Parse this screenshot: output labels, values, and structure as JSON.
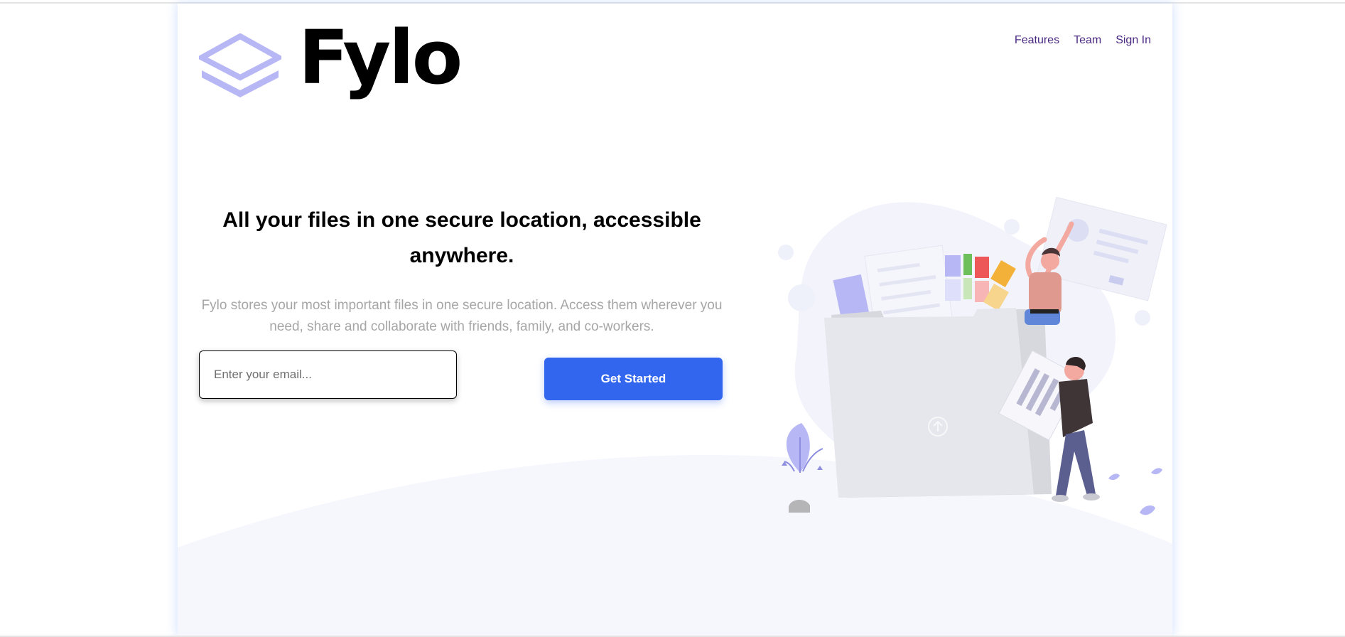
{
  "brand": {
    "name": "Fylo",
    "logo_color": "#b7b7f5"
  },
  "nav": {
    "features": "Features",
    "team": "Team",
    "sign_in": "Sign In"
  },
  "hero": {
    "headline": "All your files in one secure location, accessible anywhere.",
    "subtext": "Fylo stores your most important files in one secure location. Access them wherever you need, share and collaborate with friends, family, and co-workers."
  },
  "form": {
    "email_placeholder": "Enter your email...",
    "email_value": "",
    "cta_label": "Get Started"
  },
  "colors": {
    "accent": "#3366ee",
    "nav_link": "#4b2a82",
    "muted_text": "#a6a6a6",
    "ground": "#f6f7fd"
  },
  "illustration": {
    "icon": "file-upload-illustration"
  }
}
